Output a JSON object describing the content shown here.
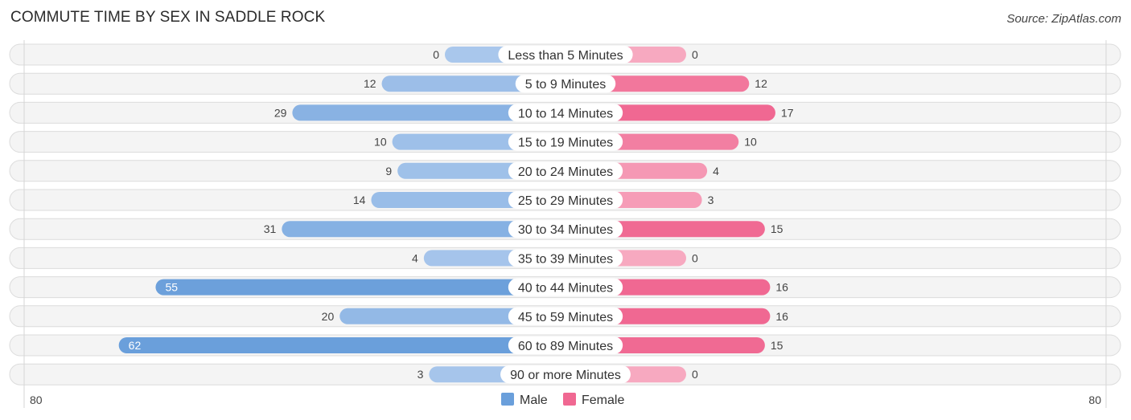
{
  "header": {
    "title": "COMMUTE TIME BY SEX IN SADDLE ROCK",
    "source": "Source: ZipAtlas.com"
  },
  "colors": {
    "male": "#6a9fdb",
    "male_light": "#a9c7ec",
    "female": "#f06892",
    "female_light": "#f7a9c0"
  },
  "chart_data": {
    "type": "bar",
    "orientation": "horizontal-diverging",
    "title": "COMMUTE TIME BY SEX IN SADDLE ROCK",
    "categories": [
      "Less than 5 Minutes",
      "5 to 9 Minutes",
      "10 to 14 Minutes",
      "15 to 19 Minutes",
      "20 to 24 Minutes",
      "25 to 29 Minutes",
      "30 to 34 Minutes",
      "35 to 39 Minutes",
      "40 to 44 Minutes",
      "45 to 59 Minutes",
      "60 to 89 Minutes",
      "90 or more Minutes"
    ],
    "series": [
      {
        "name": "Male",
        "values": [
          0,
          12,
          29,
          10,
          9,
          14,
          31,
          4,
          55,
          20,
          62,
          3
        ]
      },
      {
        "name": "Female",
        "values": [
          0,
          12,
          17,
          10,
          4,
          3,
          15,
          0,
          16,
          16,
          15,
          0
        ]
      }
    ],
    "axis": {
      "left_label": "80",
      "right_label": "80",
      "max": 80
    },
    "legend": {
      "position": "bottom-center",
      "items": [
        "Male",
        "Female"
      ]
    },
    "grid": false
  }
}
